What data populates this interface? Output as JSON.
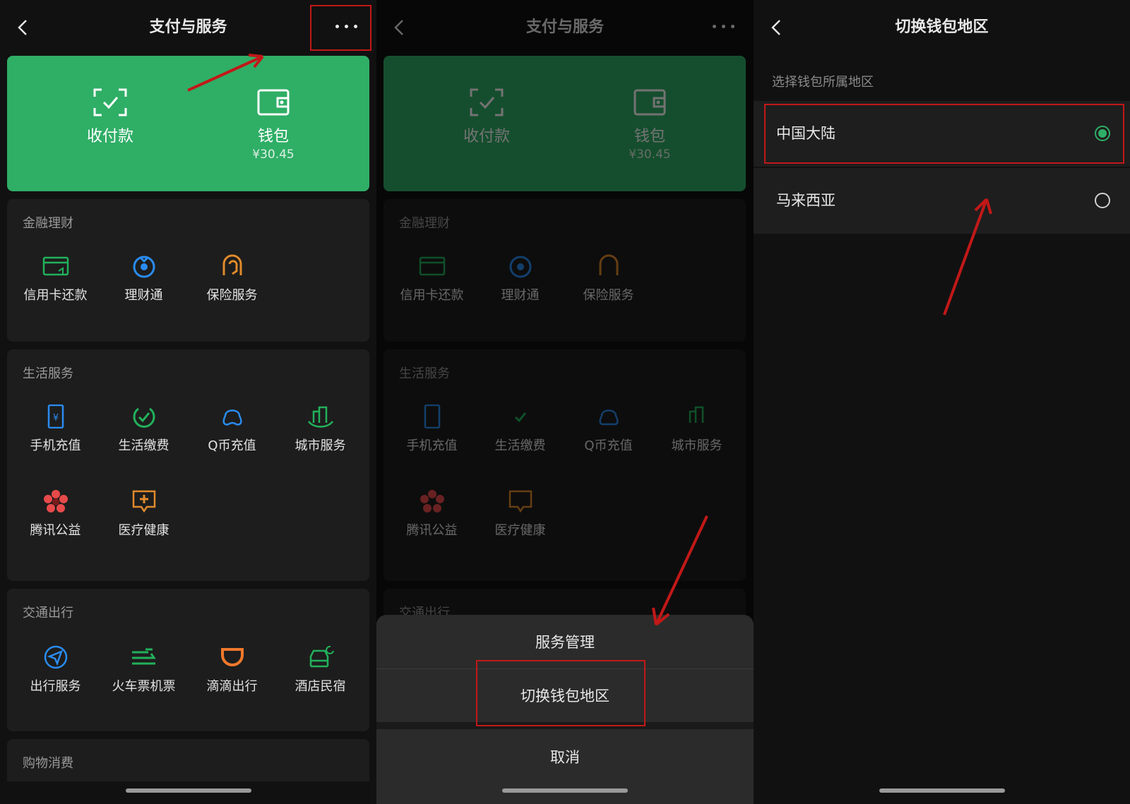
{
  "colors": {
    "accent": "#2fae66",
    "highlight": "#c21818"
  },
  "screen1": {
    "title": "支付与服务",
    "more_icon": "more-horizontal-icon",
    "hero": {
      "pay": {
        "label": "收付款",
        "icon": "scan-pay-icon"
      },
      "wallet": {
        "label": "钱包",
        "balance": "¥30.45",
        "icon": "wallet-icon"
      }
    },
    "sections": [
      {
        "title": "金融理财",
        "items": [
          {
            "label": "信用卡还款",
            "icon": "credit-card-icon"
          },
          {
            "label": "理财通",
            "icon": "wealth-icon"
          },
          {
            "label": "保险服务",
            "icon": "insurance-icon"
          }
        ]
      },
      {
        "title": "生活服务",
        "items": [
          {
            "label": "手机充值",
            "icon": "phone-topup-icon"
          },
          {
            "label": "生活缴费",
            "icon": "utility-bill-icon"
          },
          {
            "label": "Q币充值",
            "icon": "qq-coin-icon"
          },
          {
            "label": "城市服务",
            "icon": "city-service-icon"
          },
          {
            "label": "腾讯公益",
            "icon": "charity-icon"
          },
          {
            "label": "医疗健康",
            "icon": "health-icon"
          }
        ]
      },
      {
        "title": "交通出行",
        "items": [
          {
            "label": "出行服务",
            "icon": "travel-icon"
          },
          {
            "label": "火车票机票",
            "icon": "train-plane-icon"
          },
          {
            "label": "滴滴出行",
            "icon": "didi-icon"
          },
          {
            "label": "酒店民宿",
            "icon": "hotel-icon"
          }
        ]
      },
      {
        "title": "购物消费",
        "items": []
      }
    ]
  },
  "screen2": {
    "sheet": {
      "manage": "服务管理",
      "switch_region": "切换钱包地区",
      "cancel": "取消"
    }
  },
  "screen3": {
    "title": "切换钱包地区",
    "subtitle": "选择钱包所属地区",
    "regions": [
      {
        "label": "中国大陆",
        "selected": true
      },
      {
        "label": "马来西亚",
        "selected": false
      }
    ]
  }
}
